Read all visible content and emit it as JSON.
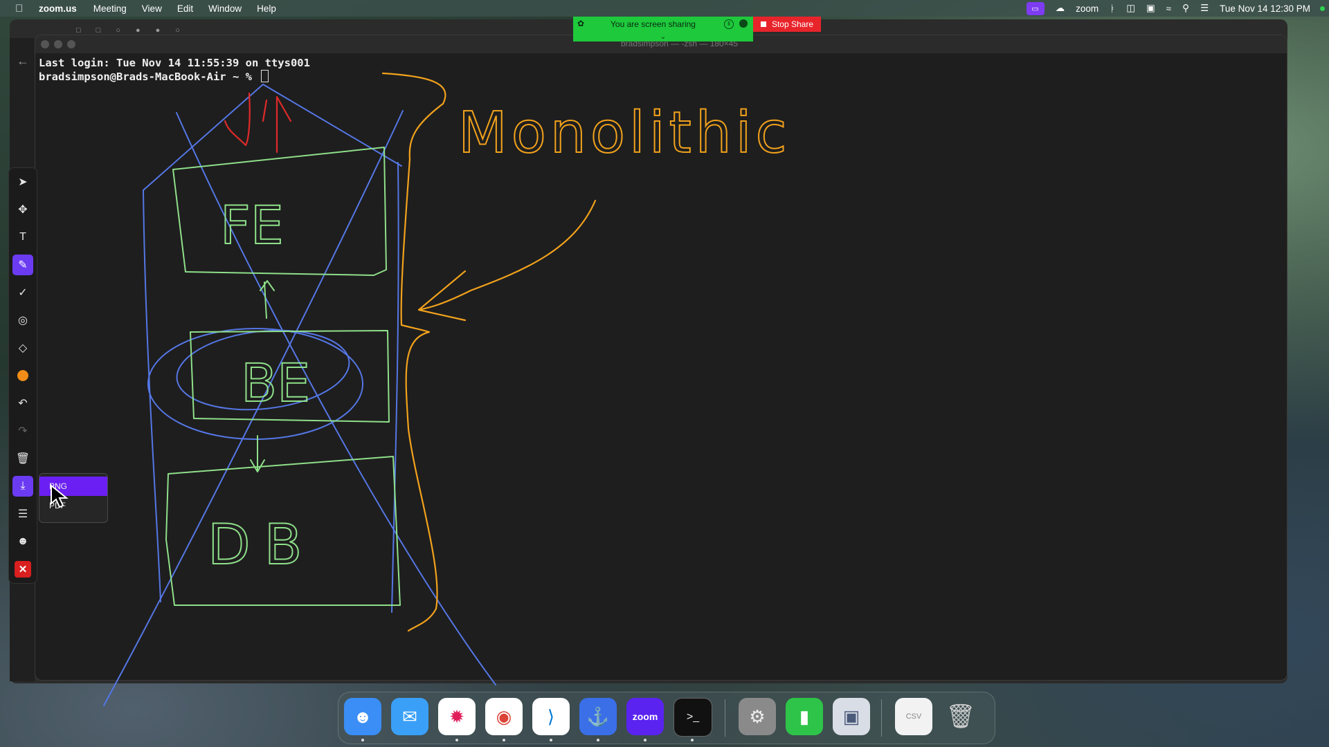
{
  "menubar": {
    "app_name": "zoom.us",
    "items": [
      "Meeting",
      "View",
      "Edit",
      "Window",
      "Help"
    ],
    "right_label_zoom": "zoom",
    "clock": "Tue Nov 14  12:30 PM"
  },
  "share_banner": {
    "status_text": "You are screen sharing",
    "stop_label": "Stop Share",
    "colors": {
      "green": "#1ec93c",
      "red": "#e8242b"
    }
  },
  "terminal": {
    "title": "bradsimpson — -zsh — 180×45",
    "lines": [
      "Last login: Tue Nov 14 11:55:39 on ttys001",
      "bradsimpson@Brads-MacBook-Air ~ % "
    ]
  },
  "annotation_toolbar": {
    "tools": [
      "mouse-pointer-icon",
      "move-icon",
      "text-icon",
      "pen-icon",
      "stamp-check-icon",
      "spotlight-icon",
      "eraser-icon",
      "color-picker-icon",
      "undo-icon",
      "redo-icon",
      "clear-icon",
      "save-icon",
      "menu-icon",
      "participants-icon",
      "close-icon"
    ],
    "active_tool": "pen-icon",
    "pen_color": "#f28c18",
    "accent": "#6b3bf2"
  },
  "save_menu": {
    "options": [
      "PNG",
      "PDF"
    ],
    "selected": "PNG"
  },
  "drawing": {
    "word": "Monolithic",
    "boxes": [
      "FE",
      "BE",
      "DB"
    ],
    "colors": {
      "orange": "#f2a21c",
      "green": "#8fe08a",
      "blue": "#5577e6",
      "red": "#e02a2a"
    }
  },
  "dock": {
    "apps": [
      "finder-icon",
      "mail-icon",
      "slack-icon",
      "chrome-icon",
      "vscode-icon",
      "docker-icon",
      "zoom-icon",
      "terminal-icon",
      "system-settings-icon",
      "numbers-icon",
      "preview-icon",
      "csv-file-icon",
      "trash-icon"
    ],
    "zoom_label": "zoom",
    "csv_label": "CSV"
  }
}
